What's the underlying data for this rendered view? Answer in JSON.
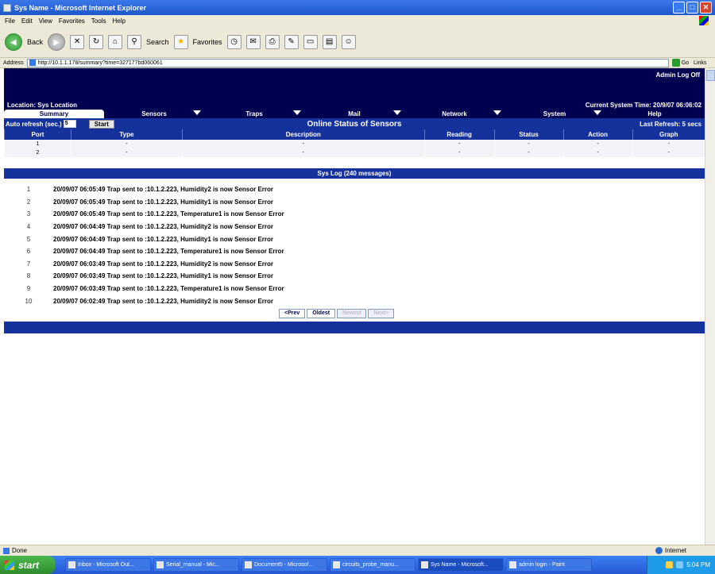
{
  "window": {
    "title": "Sys Name - Microsoft Internet Explorer",
    "controls": [
      "_",
      "□",
      "✕"
    ]
  },
  "menu": [
    "File",
    "Edit",
    "View",
    "Favorites",
    "Tools",
    "Help"
  ],
  "toolbar": {
    "back_label": "Back",
    "search_label": "Search",
    "favorites_label": "Favorites"
  },
  "address": {
    "label": "Address",
    "url": "http://10.1.1.178/summary?time=327177bd060061",
    "go_label": "Go",
    "links_label": "Links"
  },
  "header": {
    "admin_logoff": "Admin Log Off",
    "location": "Location: Sys Location",
    "system_time": "Current System Time: 20/9/07 06:06:02"
  },
  "tabs": [
    {
      "label": "Summary",
      "active": true
    },
    {
      "label": "Sensors",
      "active": false
    },
    {
      "label": "Traps",
      "active": false
    },
    {
      "label": "Mail",
      "active": false
    },
    {
      "label": "Network",
      "active": false
    },
    {
      "label": "System",
      "active": false
    },
    {
      "label": "Help",
      "active": false
    }
  ],
  "status_row": {
    "auto_refresh_label": "Auto refresh (sec.)",
    "auto_refresh_value": "5",
    "start_label": "Start",
    "title": "Online Status of Sensors",
    "last_refresh": "Last Refresh: 5 secs"
  },
  "sensor_table": {
    "columns": [
      "Port",
      "Type",
      "Description",
      "Reading",
      "Status",
      "Action",
      "Graph"
    ],
    "rows": [
      [
        "1",
        "-",
        "-",
        "-",
        "-",
        "-",
        "-"
      ],
      [
        "2",
        "-",
        "-",
        "-",
        "-",
        "-",
        "-"
      ]
    ]
  },
  "syslog": {
    "title": "Sys Log (240 messages)",
    "entries": [
      {
        "num": "1",
        "text": "20/09/07 06:05:49 Trap sent to :10.1.2.223, Humidity2 is now Sensor Error"
      },
      {
        "num": "2",
        "text": "20/09/07 06:05:49 Trap sent to :10.1.2.223, Humidity1 is now Sensor Error"
      },
      {
        "num": "3",
        "text": "20/09/07 06:05:49 Trap sent to :10.1.2.223, Temperature1 is now Sensor Error"
      },
      {
        "num": "4",
        "text": "20/09/07 06:04:49 Trap sent to :10.1.2.223, Humidity2 is now Sensor Error"
      },
      {
        "num": "5",
        "text": "20/09/07 06:04:49 Trap sent to :10.1.2.223, Humidity1 is now Sensor Error"
      },
      {
        "num": "6",
        "text": "20/09/07 06:04:49 Trap sent to :10.1.2.223, Temperature1 is now Sensor Error"
      },
      {
        "num": "7",
        "text": "20/09/07 06:03:49 Trap sent to :10.1.2.223, Humidity2 is now Sensor Error"
      },
      {
        "num": "8",
        "text": "20/09/07 06:03:49 Trap sent to :10.1.2.223, Humidity1 is now Sensor Error"
      },
      {
        "num": "9",
        "text": "20/09/07 06:03:49 Trap sent to :10.1.2.223, Temperature1 is now Sensor Error"
      },
      {
        "num": "10",
        "text": "20/09/07 06:02:49 Trap sent to :10.1.2.223, Humidity2 is now Sensor Error"
      }
    ],
    "pager": {
      "prev": "<Prev",
      "oldest": "Oldest",
      "newest": "Newest",
      "next": "Next>"
    }
  },
  "ie_status": {
    "left": "Done",
    "zone": "Internet"
  },
  "taskbar": {
    "start": "start",
    "tasks": [
      "Inbox - Microsoft Out...",
      "Serial_manual - Mic...",
      "Document5 - Microsof...",
      "circuits_probe_manu...",
      "Sys Name - Microsoft...",
      "admin login - Paint"
    ],
    "clock": "5:04 PM"
  },
  "colors": {
    "header_bg": "#000050",
    "bar_bg": "#14319c",
    "row_bg": "#f4f4f8"
  }
}
